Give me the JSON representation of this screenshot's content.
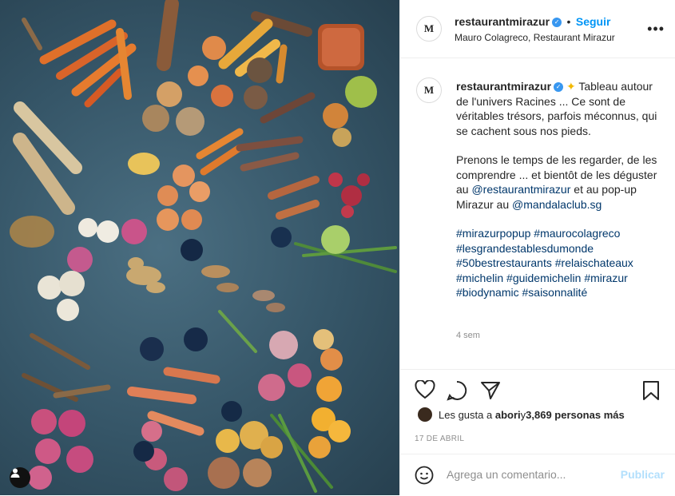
{
  "post": {
    "username": "restaurantmirazur",
    "follow_label": "Seguir",
    "location": "Mauro Colagreco, Restaurant Mirazur",
    "avatar_letter": "M",
    "more_label": "•••"
  },
  "caption": {
    "username": "restaurantmirazur",
    "paragraph1": "Tableau autour de l'univers Racines ... Ce sont de véritables trésors, parfois méconnus, qui se cachent sous nos pieds.",
    "paragraph2_start": "Prenons le temps de les regarder, de les comprendre ... et bientôt de les déguster au ",
    "mention1": "@restaurantmirazur",
    "paragraph2_mid": " et au pop-up Mirazur au ",
    "mention2": "@mandalaclub.sg",
    "hashtags": [
      "#mirazurpopup",
      "#maurocolagreco",
      "#lesgrandestablesdumonde",
      "#50bestrestaurants",
      "#relaischateaux",
      "#michelin",
      "#guidemichelin",
      "#mirazur",
      "#biodynamic",
      "#saisonnalité"
    ],
    "time": "4 sem"
  },
  "likes": {
    "prefix": "Les gusta a ",
    "user": "abori",
    "middle": " y ",
    "count": "3,869 personas más"
  },
  "date": "17 DE ABRIL",
  "comment": {
    "placeholder": "Agrega un comentario...",
    "publish_label": "Publicar"
  },
  "colors": {
    "accent": "#0095f6",
    "verified": "#3897f0",
    "link": "#00376b",
    "muted": "#8e8e8e"
  }
}
